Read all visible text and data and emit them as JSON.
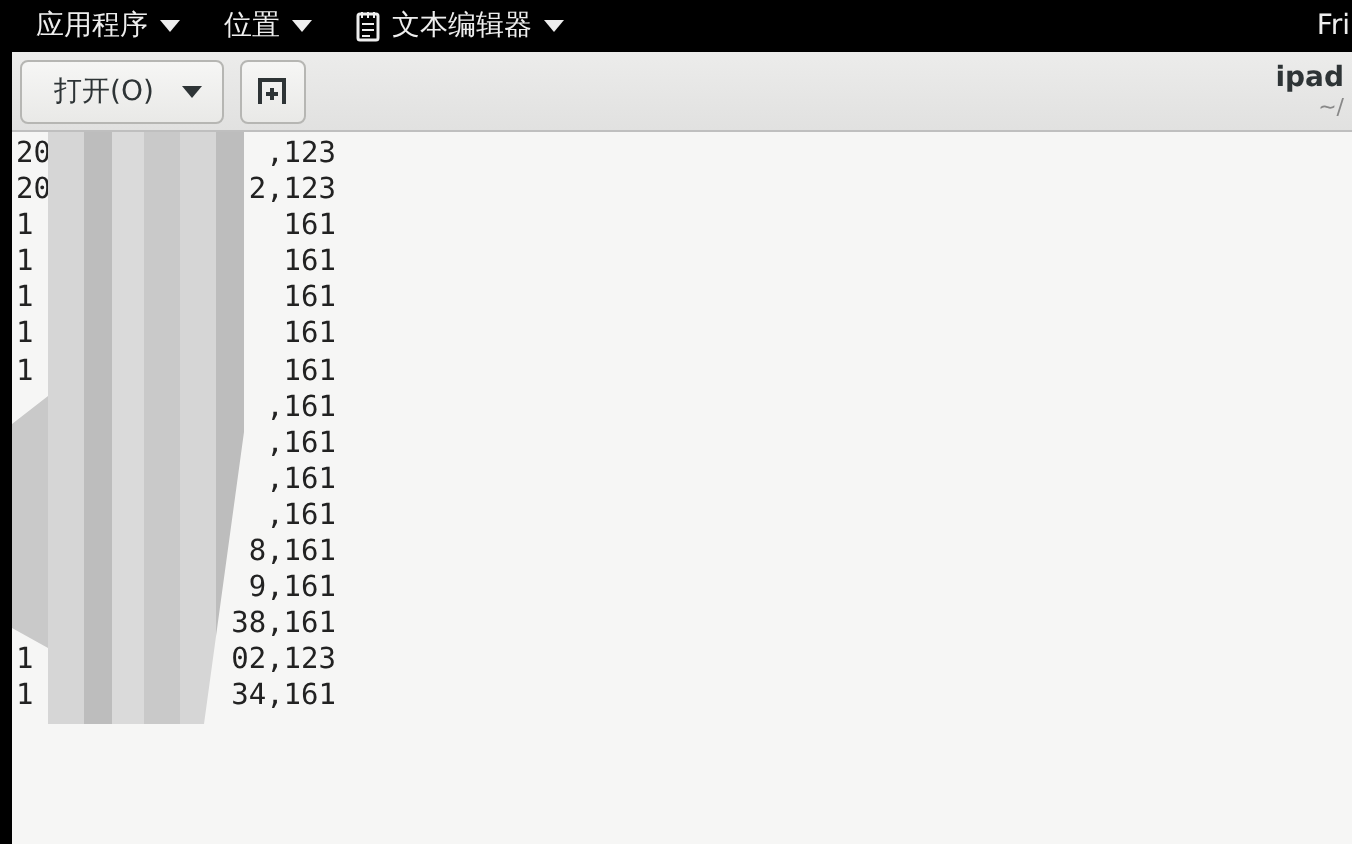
{
  "top_bar": {
    "menus": [
      {
        "label": "应用程序",
        "kind": "menu"
      },
      {
        "label": "位置",
        "kind": "menu"
      },
      {
        "label": "文本编辑器",
        "kind": "app"
      }
    ],
    "clock": "Fri"
  },
  "header": {
    "open_button": "打开(O)",
    "title": "ipad",
    "subtitle": "~/"
  },
  "lines": [
    {
      "start": "20",
      "end": ",123"
    },
    {
      "start": "20",
      "end": "2,123"
    },
    {
      "start": "1",
      "end": "161"
    },
    {
      "start": "1",
      "end": "161"
    },
    {
      "start": "1",
      "end": "161"
    },
    {
      "start": "1",
      "end": "161"
    },
    {
      "start": "1",
      "end": "161"
    },
    {
      "end": ",161"
    },
    {
      "end": ",161"
    },
    {
      "end": ",161"
    },
    {
      "end": ",161"
    },
    {
      "end": "8,161"
    },
    {
      "end": "9,161"
    },
    {
      "end": "38,161"
    },
    {
      "start": "1",
      "end": "02,123"
    },
    {
      "start": "1",
      "end": "34,161"
    }
  ]
}
